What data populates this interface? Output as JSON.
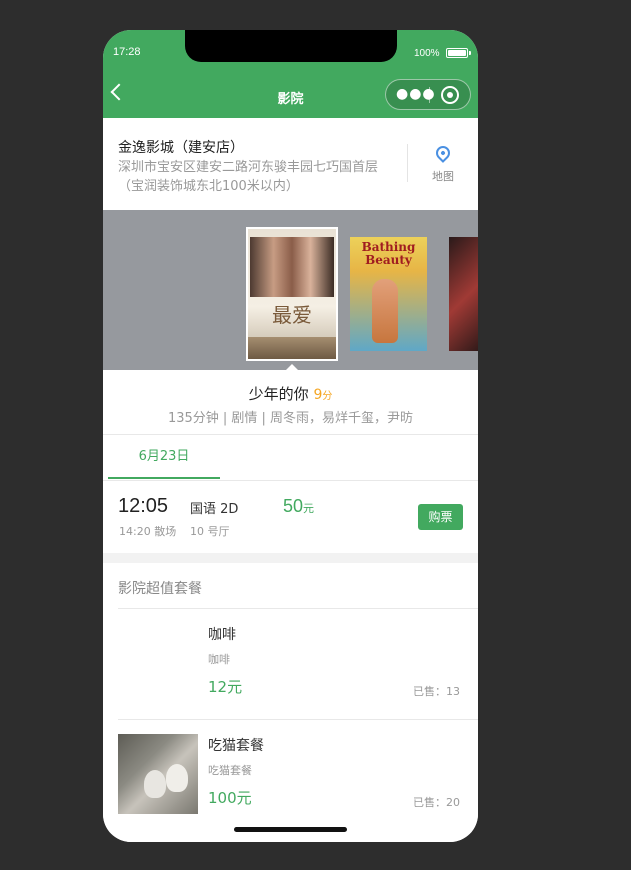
{
  "status": {
    "time": "17:28",
    "battery": "100%"
  },
  "nav": {
    "title": "影院"
  },
  "cinema": {
    "name": "金逸影城（建安店）",
    "address": "深圳市宝安区建安二路河东骏丰园七巧国首层（宝润装饰城东北100米以内）",
    "map_label": "地图"
  },
  "posters": [
    {
      "title": "最爱",
      "selected": true
    },
    {
      "title": "Bathing Beauty",
      "selected": false
    },
    {
      "title": "",
      "selected": false
    }
  ],
  "movie": {
    "title": "少年的你",
    "score": "9",
    "score_unit": "分",
    "meta": "135分钟 | 剧情 | 周冬雨，易烊千玺，尹昉"
  },
  "date_tabs": [
    {
      "label": "6月23日",
      "active": true
    }
  ],
  "session": {
    "start": "12:05",
    "end": "14:20 散场",
    "lang": "国语 2D",
    "hall": "10 号厅",
    "price": "50",
    "price_unit": "元",
    "buy_label": "购票"
  },
  "packages": {
    "header": "影院超值套餐",
    "items": [
      {
        "name": "咖啡",
        "desc": "咖啡",
        "price": "12元",
        "sold": "已售：13"
      },
      {
        "name": "吃猫套餐",
        "desc": "吃猫套餐",
        "price": "100元",
        "sold": "已售：20"
      }
    ]
  },
  "colors": {
    "brand": "#42a95f",
    "score": "#f5a623",
    "poster_bg": "#96999e"
  }
}
